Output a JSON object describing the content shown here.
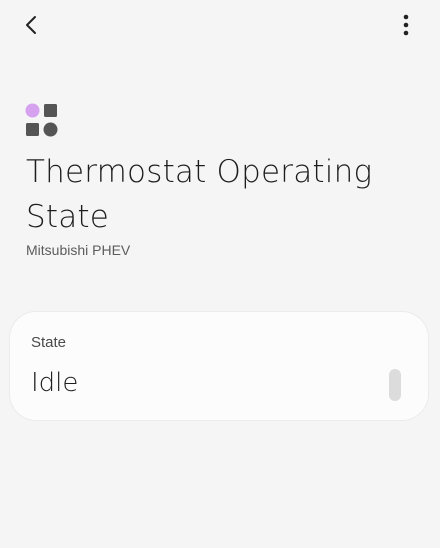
{
  "header": {
    "back_icon": "chevron-left-icon",
    "more_icon": "more-vertical-icon"
  },
  "device": {
    "icon": "capability-shapes-icon",
    "title": "Thermostat Operating State",
    "subtitle": "Mitsubishi PHEV"
  },
  "state_card": {
    "label": "State",
    "value": "Idle"
  },
  "colors": {
    "background": "#f5f5f5",
    "card": "#fcfcfc",
    "icon_accent": "#d6a2f0",
    "icon_dark": "#555555"
  }
}
